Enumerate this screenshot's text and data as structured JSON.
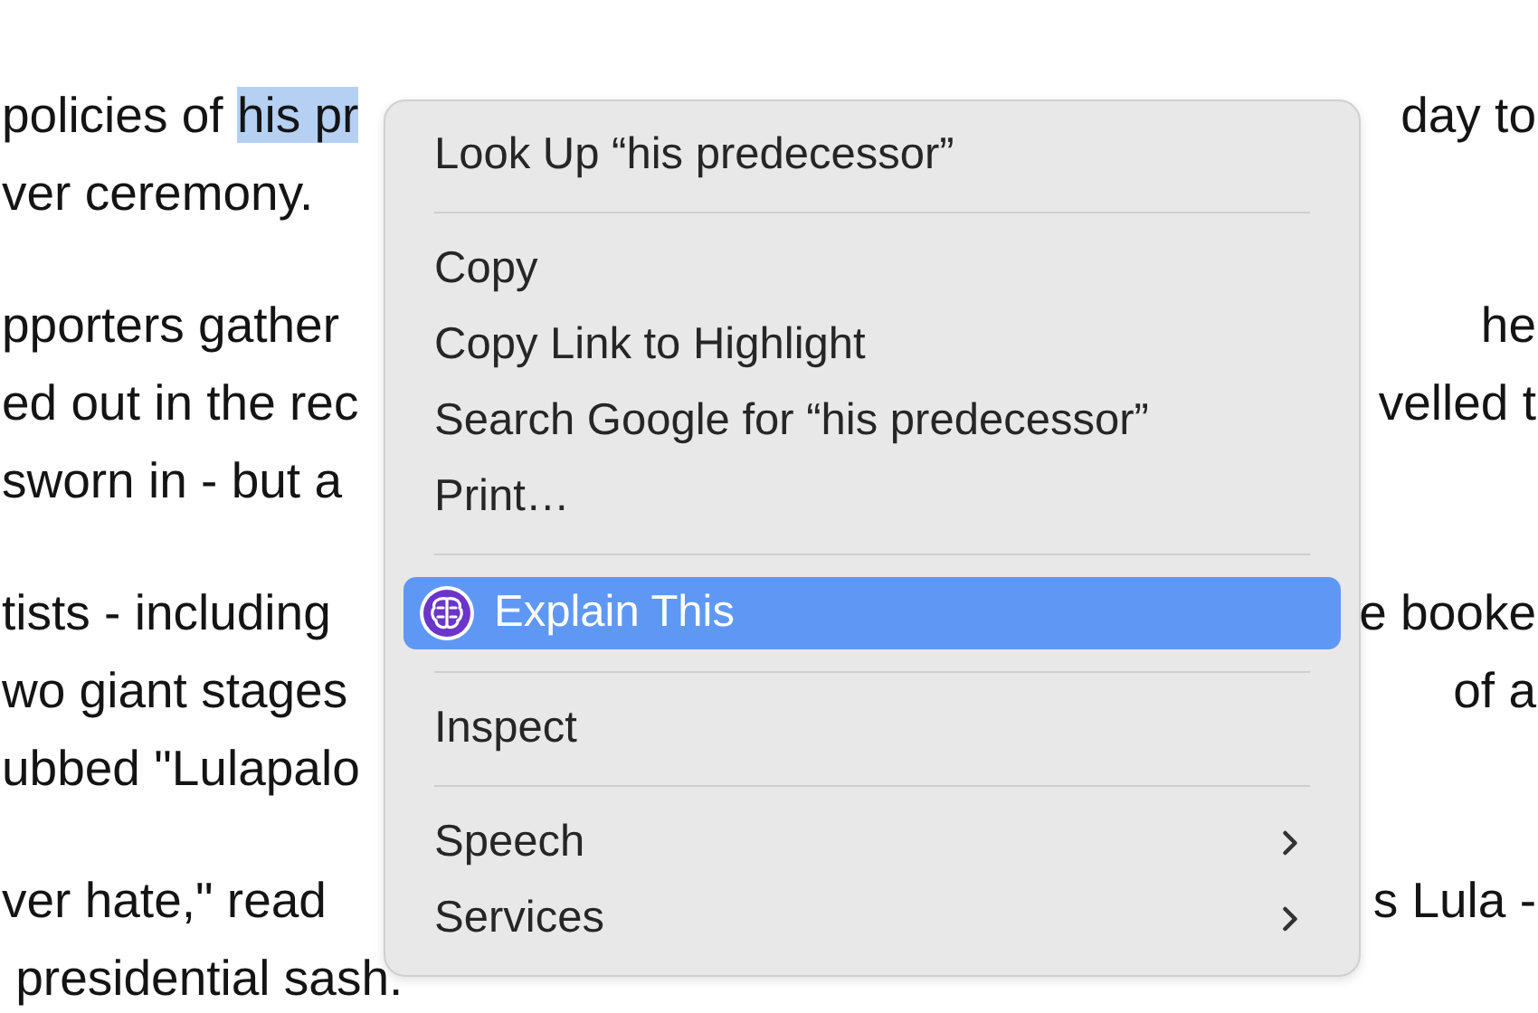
{
  "article": {
    "paragraphs": [
      {
        "lines": [
          {
            "left": "policies of ",
            "highlight": "his pr",
            "right": "day to"
          },
          {
            "left": "ver ceremony."
          }
        ]
      },
      {
        "lines": [
          {
            "left": "pporters gather",
            "right": "he"
          },
          {
            "left": "ed out in the rec",
            "right": "velled t"
          },
          {
            "left": "sworn in - but a"
          }
        ]
      },
      {
        "lines": [
          {
            "left": "tists - including",
            "right": "e booke"
          },
          {
            "left": "wo giant stages",
            "right": "of a"
          },
          {
            "left": "ubbed \"Lulapalo"
          }
        ]
      },
      {
        "lines": [
          {
            "left": "ver hate,\" read",
            "right": "s Lula -"
          },
          {
            "left": " presidential sash."
          }
        ]
      }
    ]
  },
  "context_menu": {
    "items": [
      {
        "kind": "item",
        "label": "Look Up “his predecessor”",
        "selected": false
      },
      {
        "kind": "separator"
      },
      {
        "kind": "item",
        "label": "Copy",
        "selected": false
      },
      {
        "kind": "item",
        "label": "Copy Link to Highlight",
        "selected": false
      },
      {
        "kind": "item",
        "label": "Search Google for “his predecessor”",
        "selected": false
      },
      {
        "kind": "item",
        "label": "Print…",
        "selected": false
      },
      {
        "kind": "separator"
      },
      {
        "kind": "app",
        "label": "Explain This",
        "selected": true
      },
      {
        "kind": "separator"
      },
      {
        "kind": "item",
        "label": "Inspect",
        "selected": false
      },
      {
        "kind": "separator"
      },
      {
        "kind": "submenu",
        "label": "Speech",
        "selected": false
      },
      {
        "kind": "submenu",
        "label": "Services",
        "selected": false
      }
    ]
  }
}
